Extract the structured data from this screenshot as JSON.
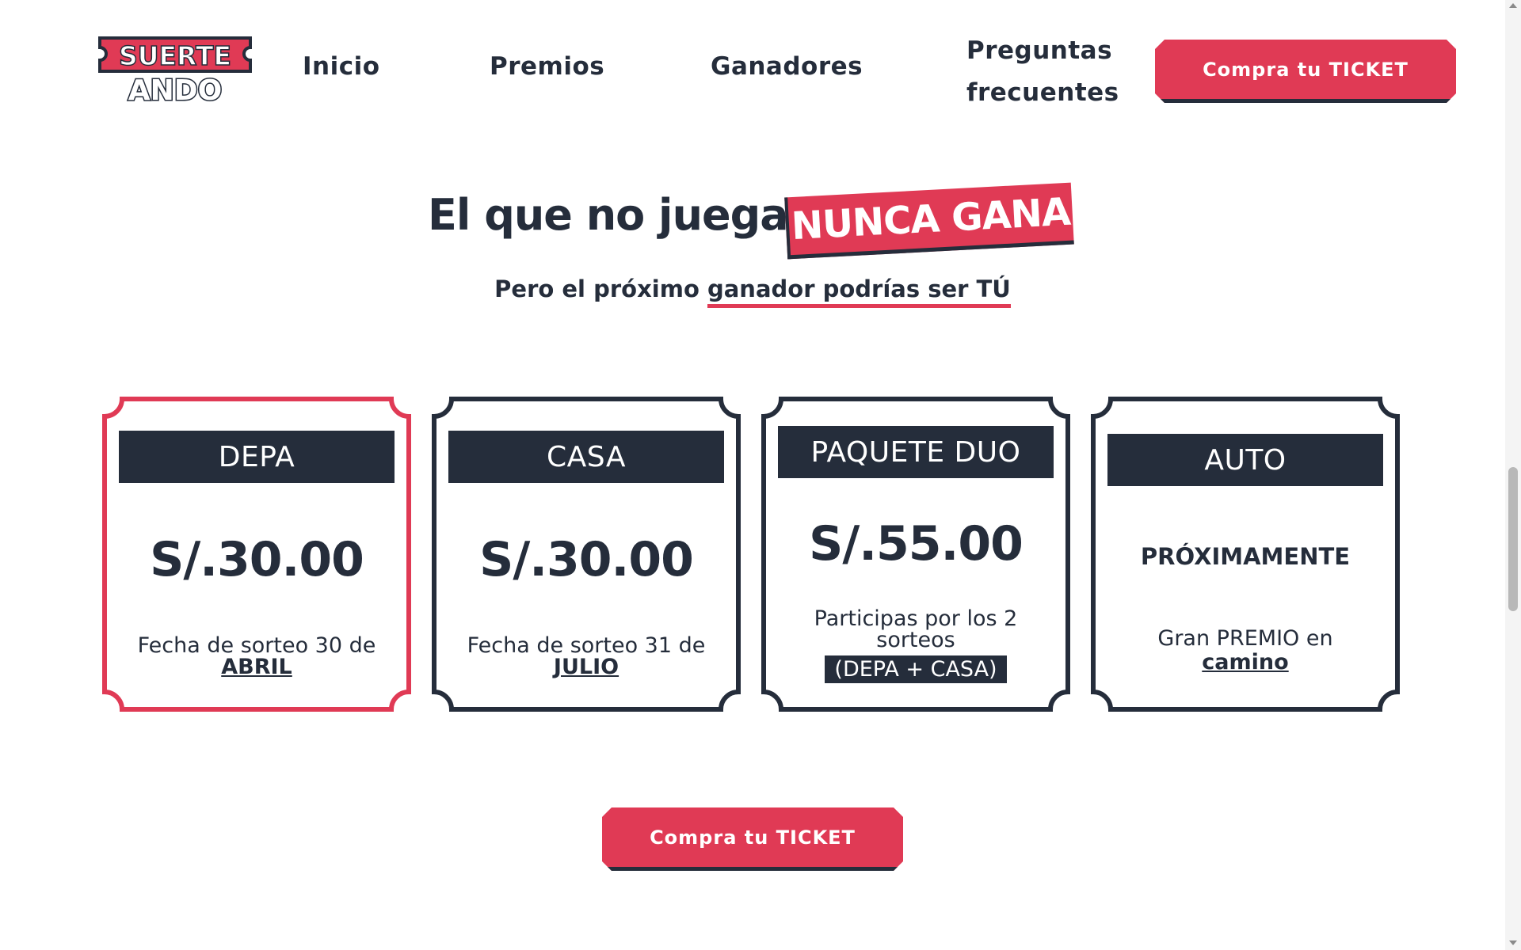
{
  "header": {
    "logo": {
      "line1": "SUERTE",
      "line2": "ANDO"
    },
    "nav": {
      "inicio": "Inicio",
      "premios": "Premios",
      "ganadores": "Ganadores",
      "faq_line1": "Preguntas",
      "faq_line2": "frecuentes"
    },
    "cta_label": "Compra tu TICKET"
  },
  "hero": {
    "title": "El que no juega,",
    "highlight": "NUNCA GANA",
    "subtitle_prefix": "Pero el próximo ",
    "subtitle_underlined": "ganador podrías ser TÚ"
  },
  "cards": [
    {
      "title": "DEPA",
      "price": "S/.30.00",
      "desc_prefix": "Fecha de sorteo 30 de",
      "desc_emph": "ABRIL",
      "selected": true
    },
    {
      "title": "CASA",
      "price": "S/.30.00",
      "desc_prefix": "Fecha de sorteo 31 de",
      "desc_emph": "JULIO",
      "selected": false
    },
    {
      "title": "PAQUETE DUO",
      "price": "S/.55.00",
      "desc_prefix": "Participas por los 2 sorteos",
      "desc_tag": "(DEPA + CASA)",
      "selected": false
    },
    {
      "title": "AUTO",
      "status": "PRÓXIMAMENTE",
      "desc_prefix": "Gran PREMIO en",
      "desc_emph": "camino",
      "selected": false
    }
  ],
  "main_cta_label": "Compra tu TICKET",
  "colors": {
    "accent": "#e03a55",
    "dark": "#252d3b",
    "background": "#ffffff"
  }
}
